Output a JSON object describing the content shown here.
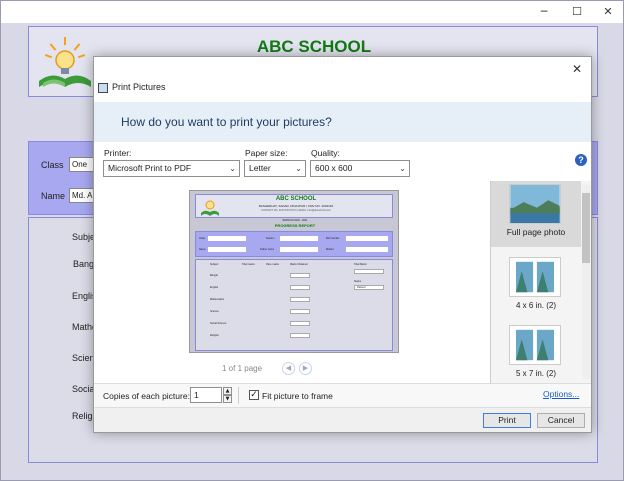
{
  "app": {
    "school_name": "ABC SCHOOL",
    "class_label": "Class",
    "class_value": "One",
    "name_label": "Name",
    "name_value": "Md. A",
    "subjects": [
      "Subje",
      "Bang",
      "Englis",
      "Mathe",
      "Scien",
      "Socia",
      "Religi"
    ],
    "window_buttons": {
      "minimize": "─",
      "maximize": "☐",
      "close": "✕"
    }
  },
  "dialog": {
    "title": "Print Pictures",
    "question": "How do you want to print your pictures?",
    "close_glyph": "✕",
    "printer_label": "Printer:",
    "printer_value": "Microsoft Print to PDF",
    "paper_label": "Paper size:",
    "paper_value": "Letter",
    "quality_label": "Quality:",
    "quality_value": "600 x 600",
    "help_glyph": "?",
    "page_indicator": "1 of 1 page",
    "layouts": [
      {
        "label": "Full page photo"
      },
      {
        "label": "4 x 6 in. (2)"
      },
      {
        "label": "5 x 7 in. (2)"
      }
    ],
    "copies_label": "Copies of each picture:",
    "copies_value": "1",
    "fit_label": "Fit picture to frame",
    "fit_checked": true,
    "options_link": "Options...",
    "print_label": "Print",
    "cancel_label": "Cancel"
  },
  "preview": {
    "school_name": "ABC SCHOOL",
    "address": "BASHERHAT, SADAR, DINAJPUR | CMV NO. 2002145",
    "contact": "CONTACT NO. 01XXXXXXXXX | EMAIL: info@abcschool.com",
    "session": "SESSION 2020 - 2021",
    "report_title": "PROGRESS REPORT",
    "fields": [
      "Class",
      "Section",
      "Roll number",
      "Name",
      "Father name",
      "Mother"
    ],
    "table_headers": [
      "Subject",
      "Total marks",
      "Pass marks",
      "Marks Obtained"
    ],
    "table_rows": [
      "Bangla",
      "English",
      "Mathematics",
      "Science",
      "Social Science",
      "Religion"
    ],
    "side_labels": [
      "Total Marks",
      "Status"
    ],
    "status_value": "Passed"
  },
  "colors": {
    "accent": "#3c7fd8",
    "school_green": "#127a14",
    "form_purple": "#a8a8f0",
    "banner_blue": "#e6eef7"
  }
}
